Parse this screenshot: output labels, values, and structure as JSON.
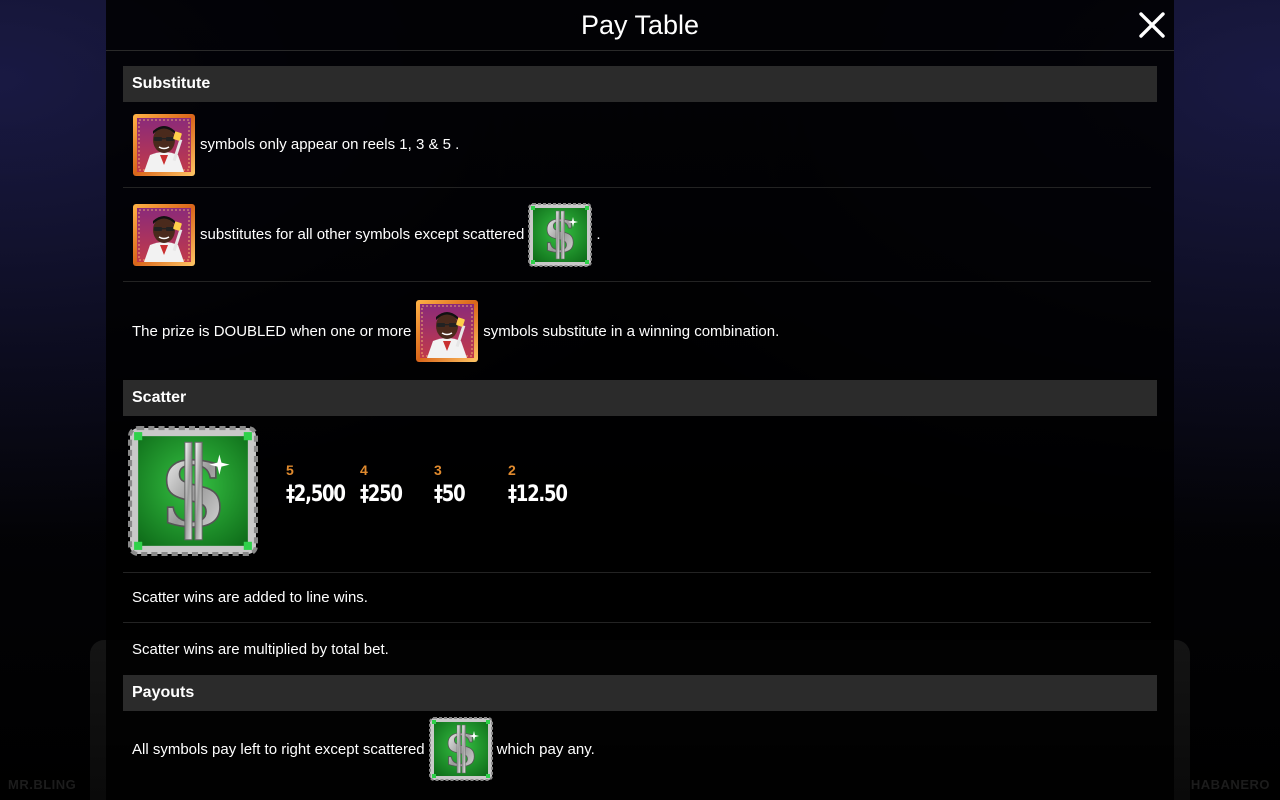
{
  "brand": {
    "left": "MR.BLING",
    "right": "HABANERO"
  },
  "header": {
    "title": "Pay Table",
    "close_icon": "close-icon"
  },
  "substitute": {
    "heading": "Substitute",
    "rows": [
      {
        "text": "symbols only appear on reels 1, 3 & 5 ."
      },
      {
        "text": "substitutes for all other symbols except scattered",
        "suffix": "."
      },
      {
        "prefix": "The prize is DOUBLED when one or more",
        "text": "symbols substitute in a winning combination."
      }
    ]
  },
  "scatter": {
    "heading": "Scatter",
    "pays": [
      {
        "count": "5",
        "value": "‡2,500"
      },
      {
        "count": "4",
        "value": "‡250"
      },
      {
        "count": "3",
        "value": "‡50"
      },
      {
        "count": "2",
        "value": "‡12.50"
      }
    ],
    "notes": [
      "Scatter wins are added to line wins.",
      "Scatter wins are multiplied by total bet."
    ]
  },
  "payouts": {
    "heading": "Payouts",
    "prefix": "All symbols pay left to right except scattered",
    "suffix": "which pay any."
  },
  "colors": {
    "section_header_bg": "#2b2b2b",
    "pay_count": "#e08a2e",
    "wild_frame": "#e0771c",
    "scatter_green": "#1f9a2c"
  }
}
